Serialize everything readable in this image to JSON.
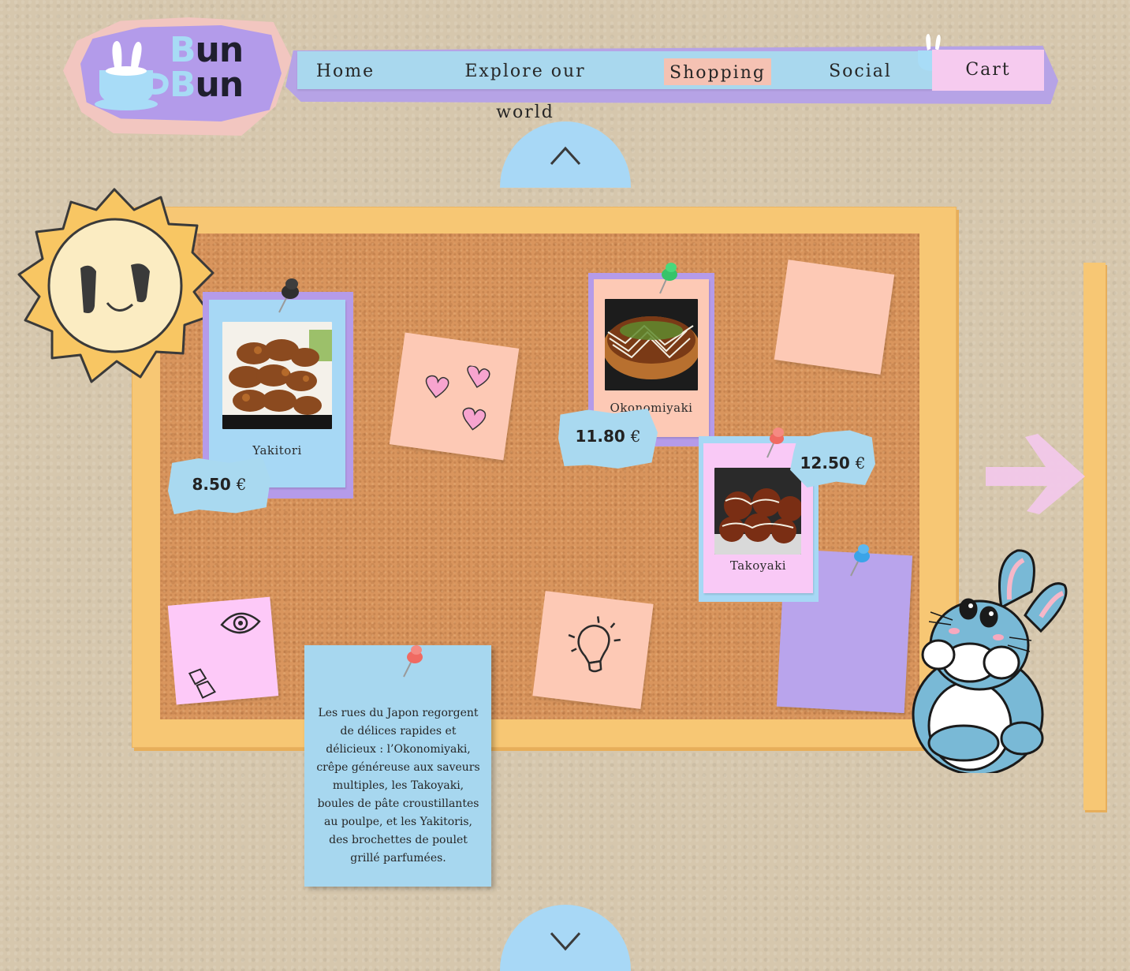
{
  "logo": {
    "line1_first": "B",
    "line1_rest": "un",
    "line2_first": "B",
    "line2_rest": "un"
  },
  "nav": {
    "items": [
      "Home",
      "Explore our world",
      "Shopping",
      "Social"
    ],
    "active": "Shopping",
    "cart_label": "Cart"
  },
  "products": [
    {
      "name": "Yakitori",
      "price_value": "8.50",
      "currency": "€"
    },
    {
      "name": "Okonomiyaki",
      "price_value": "11.80",
      "currency": "€"
    },
    {
      "name": "Takoyaki",
      "price_value": "12.50",
      "currency": "€"
    }
  ],
  "description": "Les rues du Japon regorgent de délices rapides et délicieux : l’Okonomiyaki, crêpe généreuse aux saveurs multiples, les Takoyaki, boules de pâte croustillantes au poulpe, et les Yakitoris, des brochettes de poulet grillé parfumées.",
  "colors": {
    "background": "#d6c7ad",
    "nav_bar": "#a9d8ee",
    "nav_active": "#f5c2b3",
    "cart": "#f6cbef",
    "lavender": "#b59be9",
    "sky_blue": "#a8d8f6",
    "peach": "#fdc9b5",
    "pink": "#fdc9f8",
    "cork": "#d9955d",
    "frame": "#f7c774"
  },
  "icons": [
    "cup-bunny-icon",
    "chevron-up-icon",
    "chevron-down-icon",
    "arrow-right-icon",
    "eye-icon",
    "lightbulb-icon",
    "hearts-icon",
    "push-pin-icon",
    "sun-mascot",
    "bunny-mascot"
  ]
}
